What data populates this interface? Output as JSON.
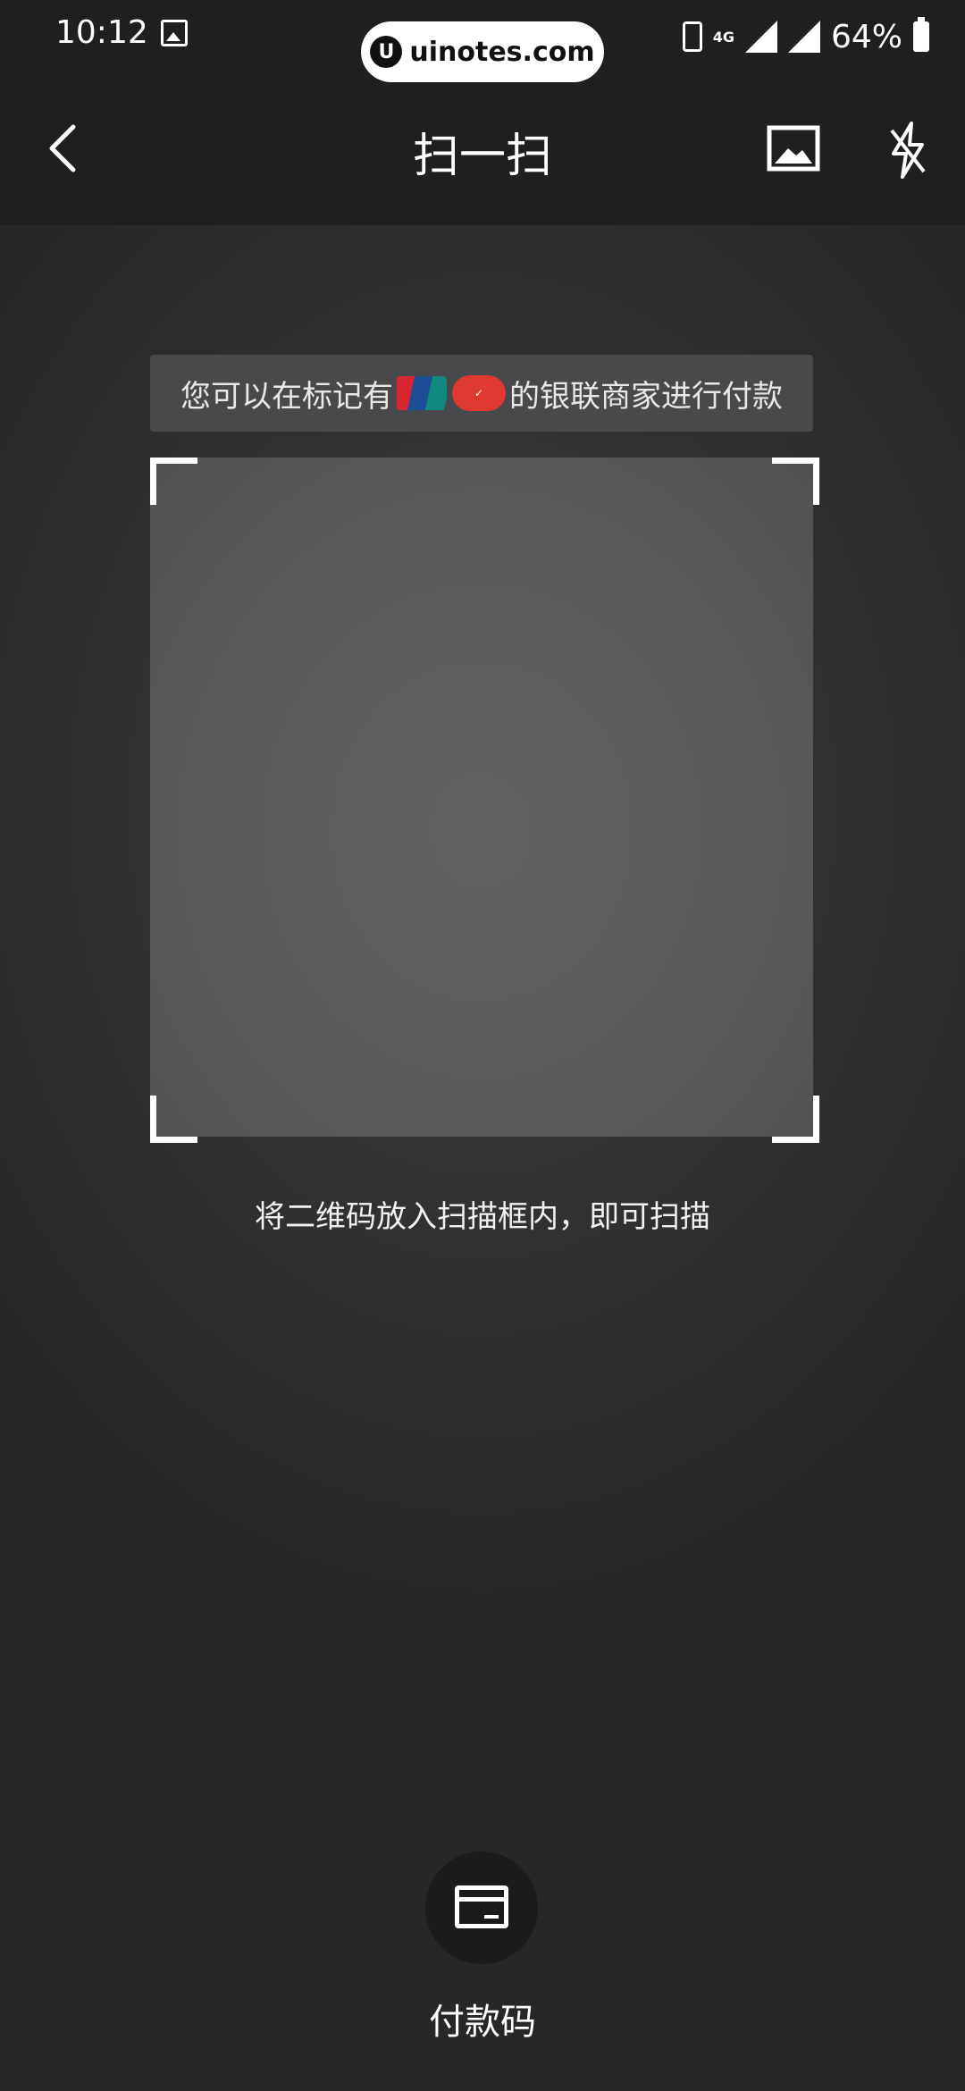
{
  "status_bar": {
    "time": "10:12",
    "network": "4G",
    "battery": "64%"
  },
  "watermark": {
    "logo": "U",
    "text": "uinotes.com"
  },
  "nav": {
    "title": "扫一扫"
  },
  "banner": {
    "text_before": "您可以在标记有",
    "unionpay_logo_text": "UnionPay 银联",
    "quickpass_logo_text": "闪付QuickPass",
    "text_after": "的银联商家进行付款"
  },
  "scan": {
    "hint": "将二维码放入扫描框内，即可扫描"
  },
  "pay_code": {
    "label": "付款码"
  },
  "colors": {
    "topbar": "#1e1f21",
    "unionpay_red": "#d7262f",
    "unionpay_blue": "#1c4d97",
    "unionpay_green": "#0f8a7e",
    "quickpass_red": "#e03a30"
  }
}
